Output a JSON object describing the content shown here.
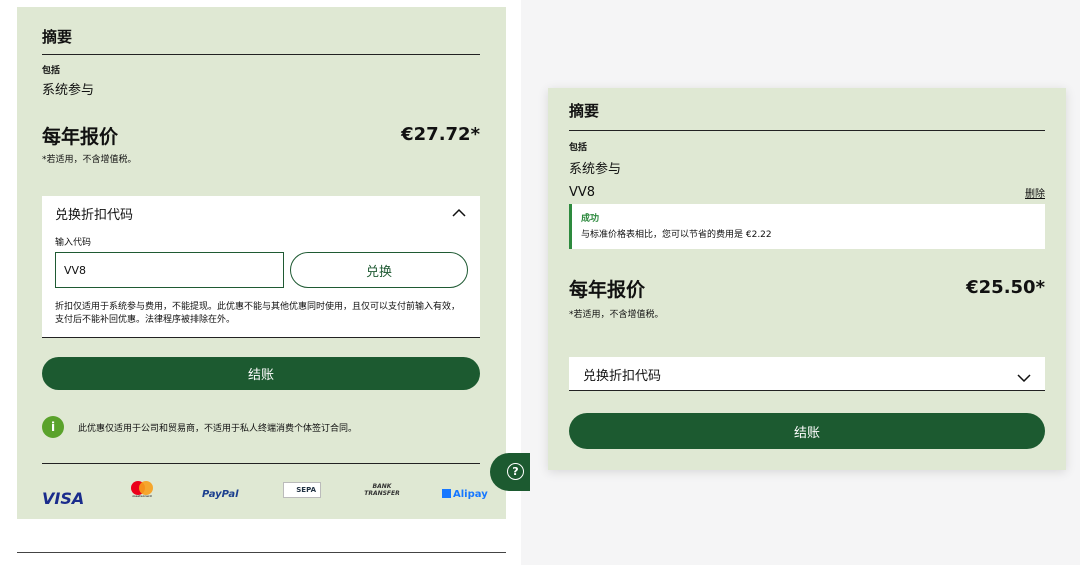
{
  "left": {
    "summary_title": "摘要",
    "includes_label": "包括",
    "plan": "系统参与",
    "annual_label": "每年报价",
    "price": "€27.72*",
    "vat_note": "*若适用，不含增值税。",
    "voucher": {
      "title": "兑换折扣代码",
      "input_label": "输入代码",
      "input_value": "VV8",
      "redeem": "兑换",
      "terms": "折扣仅适用于系统参与费用，不能提现。此优惠不能与其他优惠同时使用，且仅可以支付前输入有效，支付后不能补回优惠。法律程序被排除在外。"
    },
    "checkout": "结账",
    "info_text": "此优惠仅适用于公司和贸易商，不适用于私人终端消费个体签订合同。",
    "payments": [
      "VISA",
      "mastercard",
      "PayPal",
      "SEPA",
      "BANK TRANSFER",
      "Alipay"
    ]
  },
  "right": {
    "summary_title": "摘要",
    "includes_label": "包括",
    "plan": "系统参与",
    "code": "VV8",
    "remove": "删除",
    "success_title": "成功",
    "success_message": "与标准价格表相比，您可以节省的费用是 €2.22",
    "annual_label": "每年报价",
    "price": "€25.50*",
    "vat_note": "*若适用，不含增值税。",
    "voucher_title": "兑换折扣代码",
    "checkout": "结账"
  }
}
